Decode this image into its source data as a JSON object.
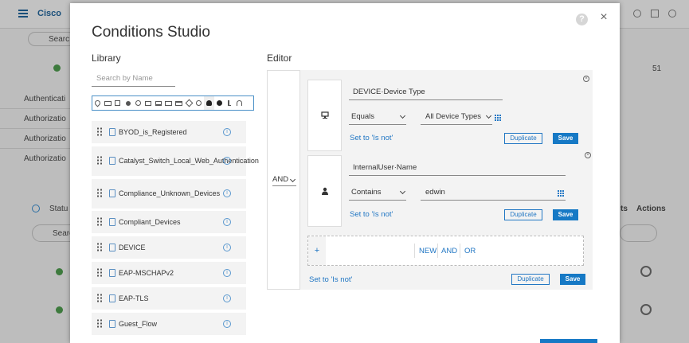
{
  "background": {
    "brand": "Cisco",
    "left_labels": [
      "Authenticati",
      "Authorizatio",
      "Authorizatio",
      "Authorizatio"
    ],
    "search_fragment": "Searc",
    "status_fragment": "Statu",
    "search_fragment2": "Searc",
    "column_headers": [
      "ts",
      "Actions"
    ],
    "count_right": "51"
  },
  "modal": {
    "title": "Conditions Studio",
    "help_label": "?",
    "close_label": "×",
    "library": {
      "title": "Library",
      "search_placeholder": "Search by Name",
      "filter_icons": [
        "location-pin-icon",
        "id-card-icon",
        "square-icon",
        "users-icon",
        "group-icon",
        "monitor-icon",
        "desktop-icon",
        "display-icon",
        "card-icon",
        "document-icon",
        "clock-icon",
        "person-icon",
        "checkmark-badge-icon",
        "bluetooth-icon",
        "wifi-icon"
      ],
      "items": [
        {
          "label": "BYOD_is_Registered"
        },
        {
          "label": "Catalyst_Switch_Local_Web_Authentication"
        },
        {
          "label": "Compliance_Unknown_Devices"
        },
        {
          "label": "Compliant_Devices"
        },
        {
          "label": "DEVICE"
        },
        {
          "label": "EAP-MSCHAPv2"
        },
        {
          "label": "EAP-TLS"
        },
        {
          "label": "Guest_Flow"
        }
      ],
      "info_glyph": "i"
    },
    "editor": {
      "title": "Editor",
      "operator": "AND",
      "conditions": [
        {
          "attribute": "DEVICE·Device Type",
          "operator": "Equals",
          "value": "All Device Types",
          "set_not": "Set to 'Is not'",
          "duplicate": "Duplicate",
          "save": "Save"
        },
        {
          "attribute": "InternalUser·Name",
          "operator": "Contains",
          "value": "edwin",
          "set_not": "Set to 'Is not'",
          "duplicate": "Duplicate",
          "save": "Save"
        }
      ],
      "add_plus": "+",
      "add_options": [
        "NEW",
        "AND",
        "OR"
      ],
      "set_not": "Set to 'Is not'",
      "duplicate": "Duplicate",
      "save": "Save",
      "remove_glyph": "×"
    }
  }
}
